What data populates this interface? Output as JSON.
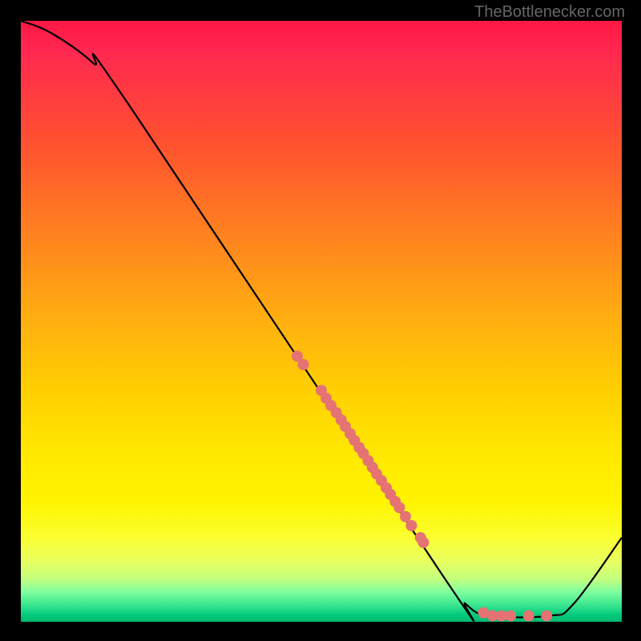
{
  "watermark": "TheBottlenecker.com",
  "chart_data": {
    "type": "line",
    "title": "",
    "xlabel": "",
    "ylabel": "",
    "xlim": [
      0,
      100
    ],
    "ylim": [
      0,
      100
    ],
    "curve": [
      {
        "x": 0,
        "y": 100
      },
      {
        "x": 5,
        "y": 98
      },
      {
        "x": 12,
        "y": 93
      },
      {
        "x": 18,
        "y": 86
      },
      {
        "x": 70,
        "y": 8
      },
      {
        "x": 74,
        "y": 3
      },
      {
        "x": 78,
        "y": 1
      },
      {
        "x": 88,
        "y": 1
      },
      {
        "x": 92,
        "y": 3
      },
      {
        "x": 100,
        "y": 14
      }
    ],
    "points": [
      {
        "x": 46,
        "y": 44.2
      },
      {
        "x": 47,
        "y": 42.8
      },
      {
        "x": 50,
        "y": 38.5
      },
      {
        "x": 50.8,
        "y": 37.2
      },
      {
        "x": 51.6,
        "y": 36
      },
      {
        "x": 52.5,
        "y": 34.8
      },
      {
        "x": 53.3,
        "y": 33.6
      },
      {
        "x": 54,
        "y": 32.5
      },
      {
        "x": 54.8,
        "y": 31.3
      },
      {
        "x": 55.5,
        "y": 30.2
      },
      {
        "x": 56.3,
        "y": 29
      },
      {
        "x": 57,
        "y": 28
      },
      {
        "x": 57.8,
        "y": 26.8
      },
      {
        "x": 58.5,
        "y": 25.7
      },
      {
        "x": 59.2,
        "y": 24.6
      },
      {
        "x": 60,
        "y": 23.5
      },
      {
        "x": 60.8,
        "y": 22.3
      },
      {
        "x": 61.5,
        "y": 21.2
      },
      {
        "x": 62.3,
        "y": 20
      },
      {
        "x": 63,
        "y": 19
      },
      {
        "x": 64,
        "y": 17.5
      },
      {
        "x": 65,
        "y": 16
      },
      {
        "x": 66.5,
        "y": 14
      },
      {
        "x": 67,
        "y": 13.2
      },
      {
        "x": 77,
        "y": 1.5
      },
      {
        "x": 78.5,
        "y": 1
      },
      {
        "x": 80,
        "y": 1
      },
      {
        "x": 81.5,
        "y": 1
      },
      {
        "x": 84.5,
        "y": 1
      },
      {
        "x": 87.5,
        "y": 1
      }
    ],
    "point_color": "#e57373",
    "point_radius": 7
  }
}
